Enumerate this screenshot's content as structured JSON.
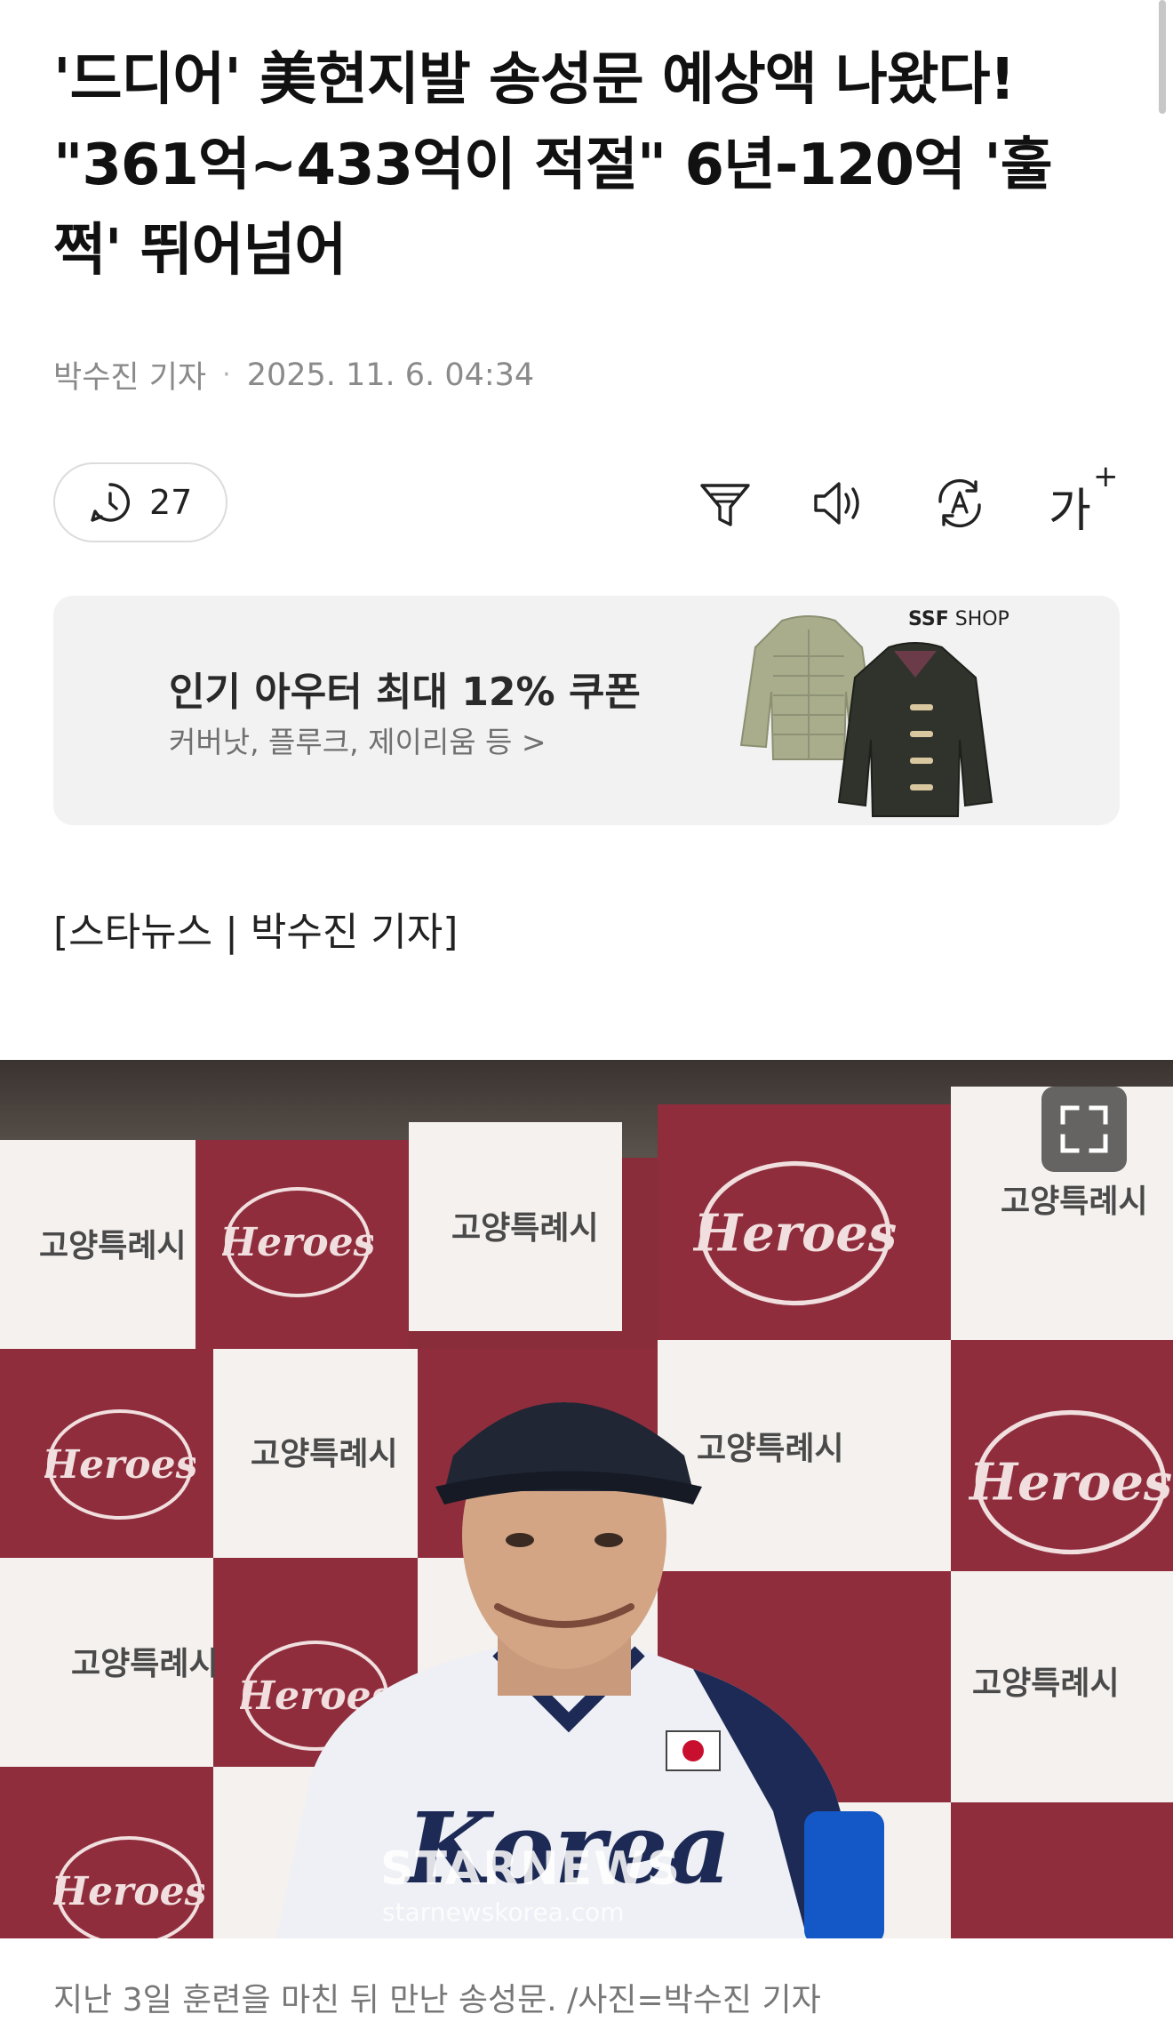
{
  "article": {
    "headline": "'드디어' 美현지발 송성문 예상액 나왔다! \"361억~433억이 적절\" 6년-120억 '훌쩍' 뛰어넘어",
    "author": "박수진 기자",
    "separator": "·",
    "datetime": "2025. 11. 6. 04:34",
    "source_line": "[스타뉴스 | 박수진 기자]",
    "caption": "지난 3일 훈련을 마친 뒤 만난 송성문. /사진=박수진 기자"
  },
  "toolbar": {
    "comment_count": "27",
    "icons": [
      "comment-clock-icon",
      "summary-filter-icon",
      "speaker-icon",
      "translate-icon",
      "font-size-icon"
    ],
    "font_label": "가",
    "font_plus": "+"
  },
  "ad": {
    "title": "인기 아우터 최대 12% 쿠폰",
    "subtitle": "커버낫, 플루크, 제이리움 등 >",
    "brand_bold": "SSF",
    "brand_rest": " SHOP"
  },
  "photo": {
    "wall_text": "고양특례시",
    "watermark": "STARNEWS",
    "watermark_url": "starnewskorea.com"
  },
  "colors": {
    "maroon": "#8f2d3c",
    "ad_bg": "#f2f2f2",
    "muted": "#8a8a8a"
  }
}
